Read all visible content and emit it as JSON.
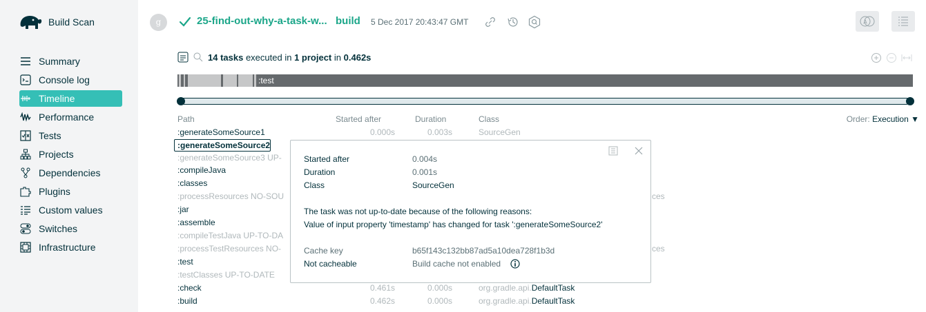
{
  "app": {
    "brand": "Build Scan"
  },
  "header": {
    "avatar_initial": "g",
    "scan_title": "25-find-out-why-a-task-w...",
    "task": "build",
    "date": "5 Dec 2017 20:43:47 GMT"
  },
  "sidebar": {
    "items": [
      {
        "label": "Summary",
        "icon": "summary-icon",
        "active": false
      },
      {
        "label": "Console log",
        "icon": "console-icon",
        "active": false
      },
      {
        "label": "Timeline",
        "icon": "timeline-icon",
        "active": true
      },
      {
        "label": "Performance",
        "icon": "performance-icon",
        "active": false
      },
      {
        "label": "Tests",
        "icon": "tests-icon",
        "active": false
      },
      {
        "label": "Projects",
        "icon": "projects-icon",
        "active": false
      },
      {
        "label": "Dependencies",
        "icon": "dependencies-icon",
        "active": false
      },
      {
        "label": "Plugins",
        "icon": "plugins-icon",
        "active": false
      },
      {
        "label": "Custom values",
        "icon": "custom-values-icon",
        "active": false
      },
      {
        "label": "Switches",
        "icon": "switches-icon",
        "active": false
      },
      {
        "label": "Infrastructure",
        "icon": "infrastructure-icon",
        "active": false
      }
    ]
  },
  "summary": {
    "count": "14 tasks",
    "executed_in": "executed in",
    "projects": "1 project",
    "in": "in",
    "time": "0.462s"
  },
  "timeline": {
    "bar_label": ":test"
  },
  "table": {
    "headers": {
      "path": "Path",
      "started": "Started after",
      "duration": "Duration",
      "class": "Class"
    },
    "order_label": "Order:",
    "order_value": "Execution",
    "rows": [
      {
        "path": ":generateSomeSource1",
        "started": "0.000s",
        "duration": "0.003s",
        "class": "SourceGen"
      },
      {
        "path": ":generateSomeSource2"
      },
      {
        "path": ":generateSomeSource3  UP-"
      },
      {
        "path": ":compileJava"
      },
      {
        "path": ":classes"
      },
      {
        "path": ":processResources  NO-SOU"
      },
      {
        "path": ":jar"
      },
      {
        "path": ":assemble"
      },
      {
        "path": ":compileTestJava  UP-TO-DA"
      },
      {
        "path": ":processTestResources  NO-"
      },
      {
        "path": ":test"
      },
      {
        "path": ":testClasses  UP-TO-DATE"
      },
      {
        "path": ":check",
        "started": "0.461s",
        "duration": "0.000s",
        "class_prefix": "org.gradle.api.",
        "class_name": "DefaultTask"
      },
      {
        "path": ":build",
        "started": "0.462s",
        "duration": "0.000s",
        "class_prefix": "org.gradle.api.",
        "class_name": "DefaultTask"
      }
    ],
    "overflow_1": "ces",
    "overflow_2": "ces"
  },
  "popover": {
    "started_label": "Started after",
    "started_value": "0.004s",
    "duration_label": "Duration",
    "duration_value": "0.001s",
    "class_label": "Class",
    "class_value": "SourceGen",
    "reason_intro": "The task was not up-to-date because of the following reasons:",
    "reason": "Value of input property 'timestamp' has changed for task ':generateSomeSource2'",
    "cache_key_label": "Cache key",
    "cache_key_value": "b65f143c132bb87ad5a10dea728f1b3d",
    "cacheable_label": "Not cacheable",
    "cacheable_value": "Build cache not enabled"
  },
  "colors": {
    "accent": "#35bfb6",
    "success": "#1ba689",
    "ink": "#02303a"
  }
}
